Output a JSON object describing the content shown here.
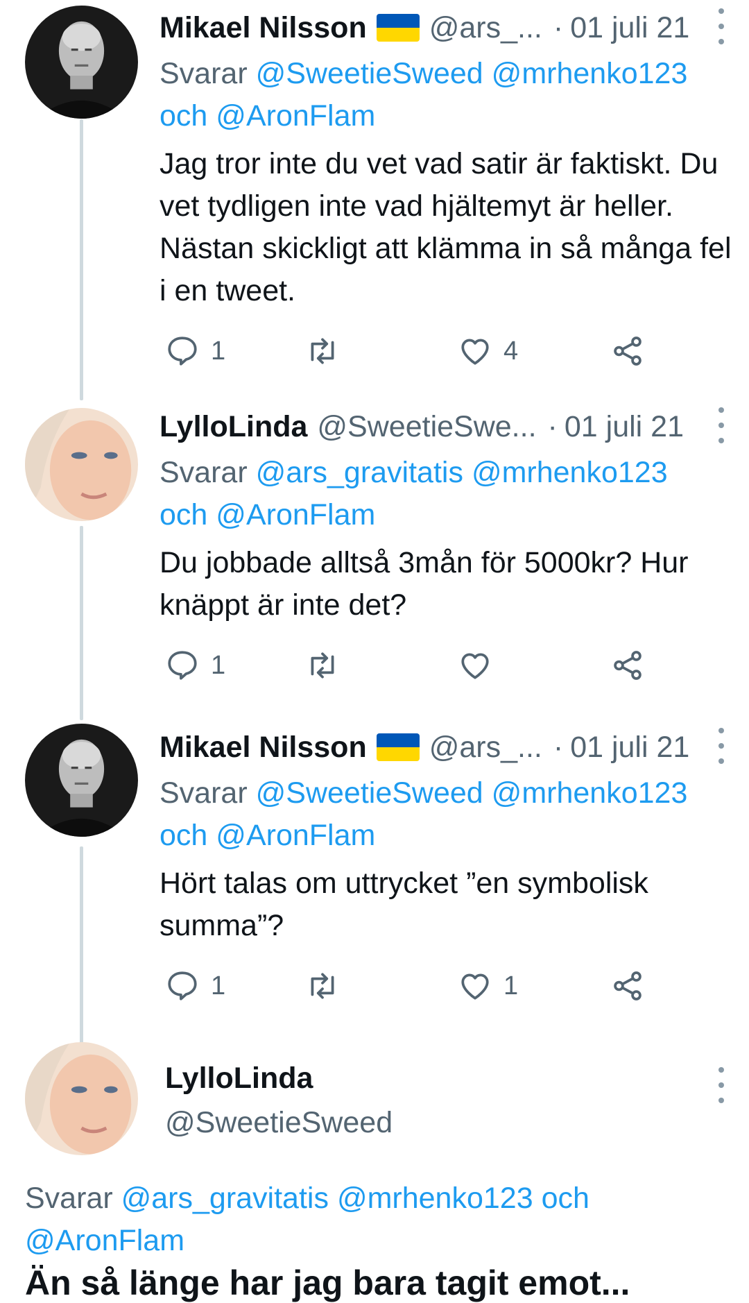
{
  "tweets": [
    {
      "name": "Mikael Nilsson",
      "has_flag": true,
      "handle": "@ars_...",
      "dot": "·",
      "date": "01 juli 21",
      "reply_prefix": "Svarar",
      "mentions": [
        "@SweetieSweed",
        "@mrhenko123"
      ],
      "and": "och",
      "last_mention": "@AronFlam",
      "text": "Jag tror inte du vet vad satir är faktiskt. Du vet tydligen inte vad hjältemyt är heller. Nästan skickligt att klämma in så många fel i en tweet.",
      "reply_count": "1",
      "retweet_count": "",
      "like_count": "4"
    },
    {
      "name": "LylloLinda",
      "has_flag": false,
      "handle": "@SweetieSwe...",
      "dot": "·",
      "date": "01 juli 21",
      "reply_prefix": "Svarar",
      "mentions": [
        "@ars_gravitatis",
        "@mrhenko123"
      ],
      "and": "och",
      "last_mention": "@AronFlam",
      "text": "Du jobbade alltså 3mån för 5000kr? Hur knäppt är inte det?",
      "reply_count": "1",
      "retweet_count": "",
      "like_count": ""
    },
    {
      "name": "Mikael Nilsson",
      "has_flag": true,
      "handle": "@ars_...",
      "dot": "·",
      "date": "01 juli 21",
      "reply_prefix": "Svarar",
      "mentions": [
        "@SweetieSweed",
        "@mrhenko123"
      ],
      "and": "och",
      "last_mention": "@AronFlam",
      "text": "Hört talas om uttrycket ”en symbolisk summa”?",
      "reply_count": "1",
      "retweet_count": "",
      "like_count": "1"
    }
  ],
  "focused_tweet": {
    "name": "LylloLinda",
    "handle": "@SweetieSweed",
    "reply_prefix": "Svarar",
    "mention_1": "@ars_gravitatis",
    "mention_2": "@mrhenko123",
    "and": "och",
    "mention_3": "@AronFlam",
    "cut_text": "Än så länge har jag bara tagit emot..."
  },
  "colors": {
    "link": "#1d9bf0",
    "muted": "#536471",
    "thread_line": "#cfd9de",
    "flag_blue": "#0057b7",
    "flag_yellow": "#ffd700"
  },
  "icons": [
    "reply-icon",
    "retweet-icon",
    "like-icon",
    "share-icon",
    "more-icon",
    "ukraine-flag-icon"
  ]
}
